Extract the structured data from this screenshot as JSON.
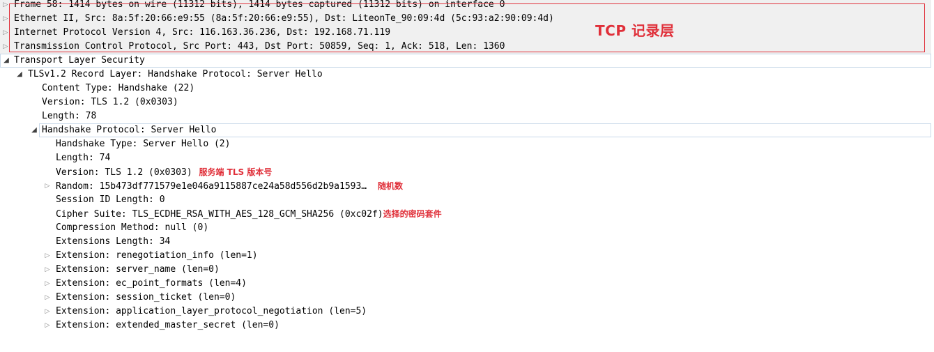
{
  "colors": {
    "annotation": "#e0303a",
    "selection_border": "#c9d9e9",
    "collapsed_background": "#f0f0f0"
  },
  "tree": {
    "frame": "Frame 58: 1414 bytes on wire (11312 bits), 1414 bytes captured (11312 bits) on interface 0",
    "ethernet": "Ethernet II, Src: 8a:5f:20:66:e9:55 (8a:5f:20:66:e9:55), Dst: LiteonTe_90:09:4d (5c:93:a2:90:09:4d)",
    "ip": "Internet Protocol Version 4, Src: 116.163.36.236, Dst: 192.168.71.119",
    "tcp": "Transmission Control Protocol, Src Port: 443, Dst Port: 50859, Seq: 1, Ack: 518, Len: 1360",
    "tls": "Transport Layer Security",
    "record_layer": "TLSv1.2 Record Layer: Handshake Protocol: Server Hello",
    "content_type": "Content Type: Handshake (22)",
    "record_version": "Version: TLS 1.2 (0x0303)",
    "record_length": "Length: 78",
    "handshake_protocol": "Handshake Protocol: Server Hello",
    "handshake_type": "Handshake Type: Server Hello (2)",
    "handshake_length": "Length: 74",
    "handshake_version": "Version: TLS 1.2 (0x0303)",
    "random": "Random: 15b473df771579e1e046a9115887ce24a58d556d2b9a1593…",
    "session_id_length": "Session ID Length: 0",
    "cipher_suite": "Cipher Suite: TLS_ECDHE_RSA_WITH_AES_128_GCM_SHA256 (0xc02f)",
    "compression": "Compression Method: null (0)",
    "extensions_length": "Extensions Length: 34",
    "extensions": [
      "Extension: renegotiation_info (len=1)",
      "Extension: server_name (len=0)",
      "Extension: ec_point_formats (len=4)",
      "Extension: session_ticket (len=0)",
      "Extension: application_layer_protocol_negotiation (len=5)",
      "Extension: extended_master_secret (len=0)"
    ]
  },
  "annotations": {
    "tcp_layer": "TCP 记录层",
    "server_version": "服务端 TLS 版本号",
    "random": "随机数",
    "cipher_suite": "选择的密码套件"
  },
  "icons": {
    "collapsed": "▷",
    "expanded": "◢"
  }
}
